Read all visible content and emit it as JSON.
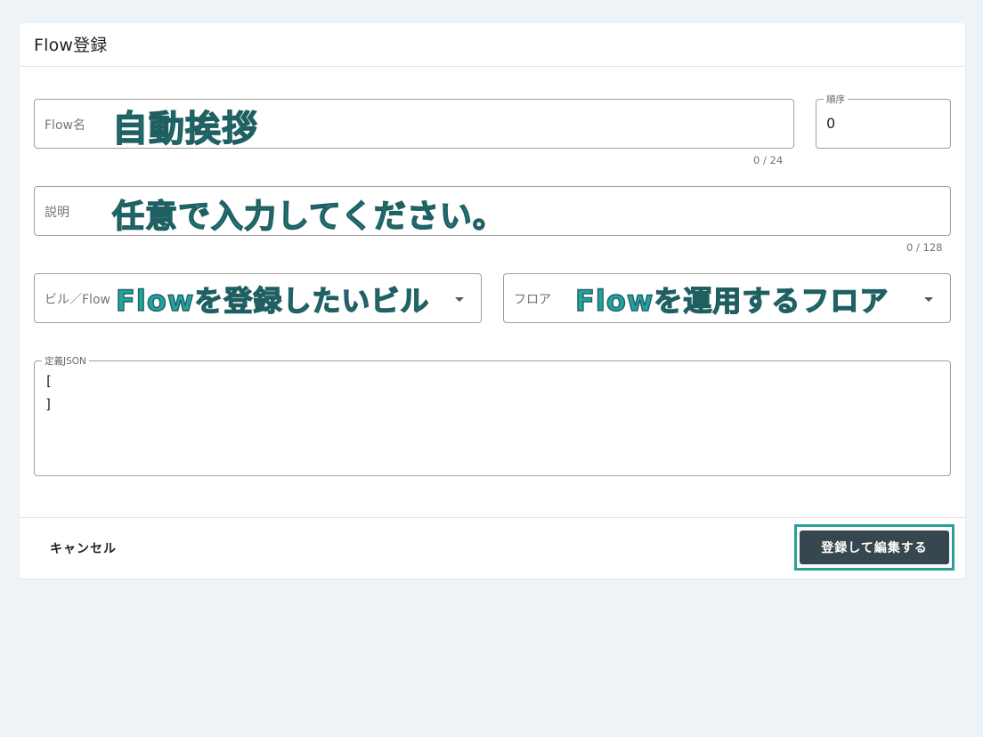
{
  "dialog": {
    "title": "Flow登録",
    "flow_name": {
      "label": "Flow名",
      "annotation": "自動挨拶",
      "counter": "0 / 24"
    },
    "order": {
      "label": "順序",
      "value": "0"
    },
    "description": {
      "label": "説明",
      "annotation": "任意で入力してください。",
      "counter": "0 / 128"
    },
    "building": {
      "label": "ビル／Flow",
      "annotation": "Flowを登録したいビル",
      "icon": "caret-down-icon"
    },
    "floor": {
      "label": "フロア",
      "annotation": "Flowを運用するフロア",
      "icon": "caret-down-icon"
    },
    "definition_json": {
      "label": "定義JSON",
      "line1": "[",
      "line2": "]"
    },
    "footer": {
      "cancel_label": "キャンセル",
      "submit_label": "登録して編集する"
    }
  },
  "colors": {
    "background": "#edf3f7",
    "button": "#37474f",
    "annotation": "#22a3a0",
    "highlight": "#2aa198"
  }
}
